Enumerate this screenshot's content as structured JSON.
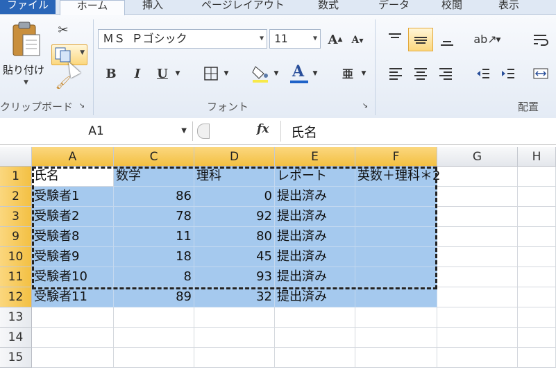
{
  "ribbon": {
    "tabs": [
      "ファイル",
      "ホーム",
      "挿入",
      "ページレイアウト",
      "数式",
      "データ",
      "校閲",
      "表示"
    ],
    "clipboard": {
      "paste_label": "貼り付け",
      "group_label": "クリップボード"
    },
    "font": {
      "name": "ＭＳ Ｐゴシック",
      "size": "11",
      "group_label": "フォント",
      "bold": "B",
      "italic": "I",
      "underline": "U",
      "color_A": "A"
    },
    "alignment": {
      "group_label": "配置"
    }
  },
  "formula_bar": {
    "name_box": "A1",
    "fx": "fx",
    "content": "氏名"
  },
  "grid": {
    "columns": [
      "A",
      "C",
      "D",
      "E",
      "F",
      "G",
      "H"
    ],
    "rows": [
      "1",
      "2",
      "3",
      "9",
      "10",
      "11",
      "12",
      "13",
      "14",
      "15"
    ],
    "header_row": [
      "氏名",
      "数学",
      "理科",
      "レポート",
      "英数＋理科＊2"
    ],
    "data": [
      [
        "受験者1",
        "86",
        "0",
        "提出済み"
      ],
      [
        "受験者2",
        "78",
        "92",
        "提出済み"
      ],
      [
        "受験者8",
        "11",
        "80",
        "提出済み"
      ],
      [
        "受験者9",
        "18",
        "45",
        "提出済み"
      ],
      [
        "受験者10",
        "8",
        "93",
        "提出済み"
      ],
      [
        "受験者11",
        "89",
        "32",
        "提出済み"
      ]
    ]
  },
  "colors": {
    "selection": "#a5c9ee",
    "header_selected": "#f3c043",
    "file_tab": "#2a66b8"
  }
}
